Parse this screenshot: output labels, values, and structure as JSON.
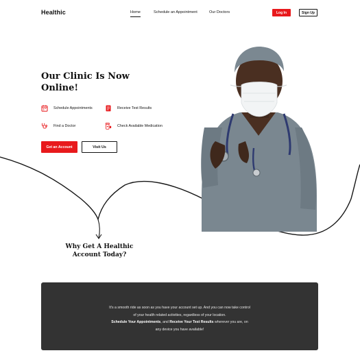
{
  "nav": {
    "logo": "Healthic",
    "links": [
      {
        "label": "Home",
        "active": true
      },
      {
        "label": "Schedule an Appointment",
        "active": false
      },
      {
        "label": "Our Doctors",
        "active": false
      }
    ],
    "login_label": "Log In",
    "signup_label": "Sign Up"
  },
  "hero": {
    "title_line1": "Our Clinic Is Now",
    "title_line2": "Online!",
    "features": [
      {
        "icon": "calendar-icon",
        "label": "Schedule Appointments"
      },
      {
        "icon": "test-results-icon",
        "label": "Receive Test Results"
      },
      {
        "icon": "stethoscope-icon",
        "label": "Find a Doctor"
      },
      {
        "icon": "medication-icon",
        "label": "Check Available Medication"
      }
    ],
    "primary_button": "Get an Account",
    "secondary_button": "Visit Us"
  },
  "why": {
    "line1": "Why Get A Healthic",
    "line2": "Account Today?"
  },
  "info": {
    "part1": "It's a smooth ride as soon as you have your account set up. And you can now take control of your health related activities, regardless of your location.",
    "bold1": "Schedule Your Appointments",
    "part2": ", and ",
    "bold2": "Receive Your Test Results",
    "part3": " wherever you are, on any device you have available!"
  },
  "colors": {
    "accent": "#e8191c",
    "dark_card": "#333333",
    "text": "#111111"
  }
}
